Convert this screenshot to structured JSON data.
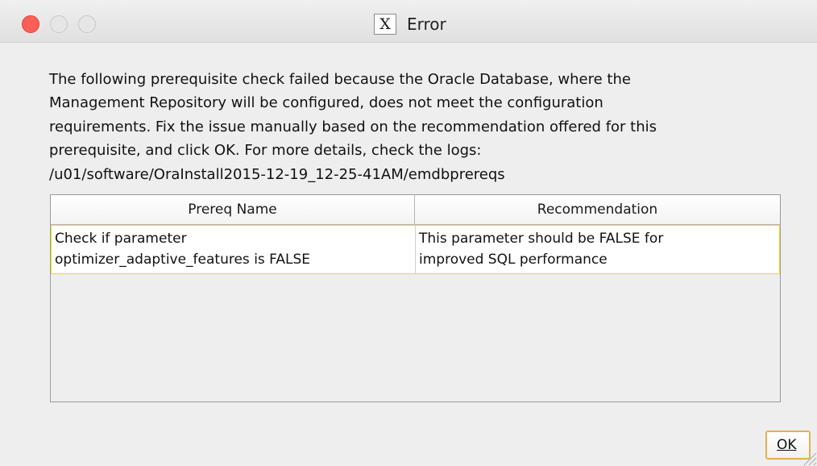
{
  "window": {
    "title": "Error",
    "app_icon_glyph": "X"
  },
  "message": {
    "lines": [
      "The following prerequisite check failed because the Oracle Database, where the",
      "Management Repository will be configured, does not meet the configuration",
      "requirements. Fix the issue manually based on the recommendation offered for this",
      "prerequisite, and click OK. For more details, check the logs:",
      "/u01/software/OraInstall2015-12-19_12-25-41AM/emdbprereqs"
    ]
  },
  "table": {
    "columns": [
      "Prereq Name",
      "Recommendation"
    ],
    "rows": [
      {
        "prereq_line1": "Check if parameter",
        "prereq_line2": "optimizer_adaptive_features is FALSE",
        "rec_line1": "This parameter should be FALSE for",
        "rec_line2": "improved SQL performance"
      }
    ]
  },
  "buttons": {
    "ok_label": "OK"
  },
  "icons": {
    "close": "close-traffic-light-icon",
    "minimize": "minimize-traffic-light-icon",
    "maximize": "maximize-traffic-light-icon",
    "app": "java-x-icon",
    "resize": "resize-grip-icon"
  },
  "colors": {
    "close_red": "#fc5f57",
    "selection_border": "#e8e400",
    "focus_border": "#e3b04a"
  }
}
